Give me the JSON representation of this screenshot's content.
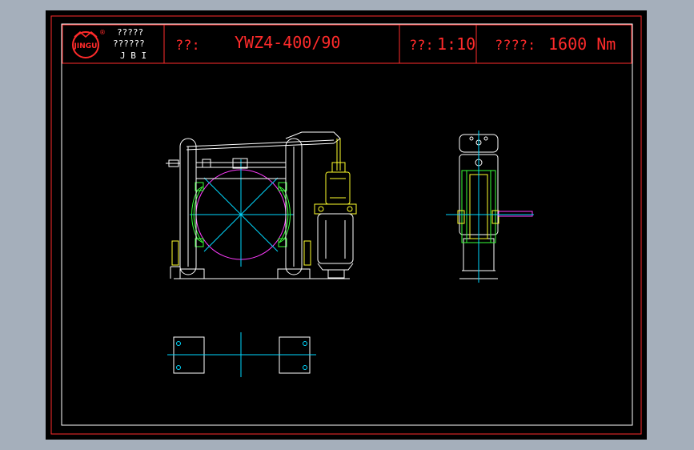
{
  "title_block": {
    "company_line1": "?????",
    "company_line2": "??????",
    "company_abbr": "J B I",
    "logo_text": "JINGU",
    "logo_mark": "®",
    "model_label": "??:",
    "model_value": "YWZ4-400/90",
    "scale_label": "??:",
    "scale_value": "1:10",
    "torque_label": "????:",
    "torque_value": "1600 Nm"
  },
  "colors": {
    "border": "#ff2b2b",
    "background": "#000000",
    "frame": "#ffffff",
    "center_line": "#00d8ff",
    "wheel": "#ff3cff",
    "shoe": "#37ff37",
    "actuator": "#ffff2b"
  }
}
